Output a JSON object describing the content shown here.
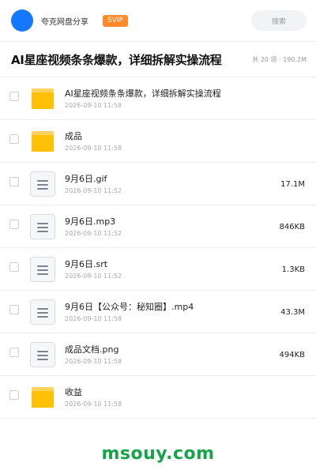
{
  "header": {
    "share_name": "夸克网盘分享",
    "badge": "SVIP",
    "search_placeholder": "搜索"
  },
  "title_bar": {
    "title": "AI星座视频条条爆款，详细拆解实操流程",
    "summary": "共 20 项 · 190.2M"
  },
  "files": [
    {
      "type": "folder",
      "name": "AI星座视频条条爆款，详细拆解实操流程",
      "date": "2026-09-10 11:58",
      "size": ""
    },
    {
      "type": "folder",
      "name": "成品",
      "date": "2026-09-10 11:58",
      "size": ""
    },
    {
      "type": "file",
      "name": "9月6日.gif",
      "date": "2026-09-10 11:52",
      "size": "17.1M"
    },
    {
      "type": "file",
      "name": "9月6日.mp3",
      "date": "2026-09-10 11:52",
      "size": "846KB"
    },
    {
      "type": "file",
      "name": "9月6日.srt",
      "date": "2026-09-10 11:52",
      "size": "1.3KB"
    },
    {
      "type": "file",
      "name": "9月6日【公众号：秘知圈】.mp4",
      "date": "2026-09-10 11:58",
      "size": "43.3M"
    },
    {
      "type": "file",
      "name": "成品文档.png",
      "date": "2026-09-10 11:58",
      "size": "494KB"
    },
    {
      "type": "folder",
      "name": "收益",
      "date": "2026-09-10 11:58",
      "size": ""
    }
  ],
  "watermark": "msouy.com",
  "colors": {
    "avatar": "#1677ff",
    "badge": "#ff8a2b",
    "folder": "#ffc107",
    "watermark": "#16a34a"
  }
}
